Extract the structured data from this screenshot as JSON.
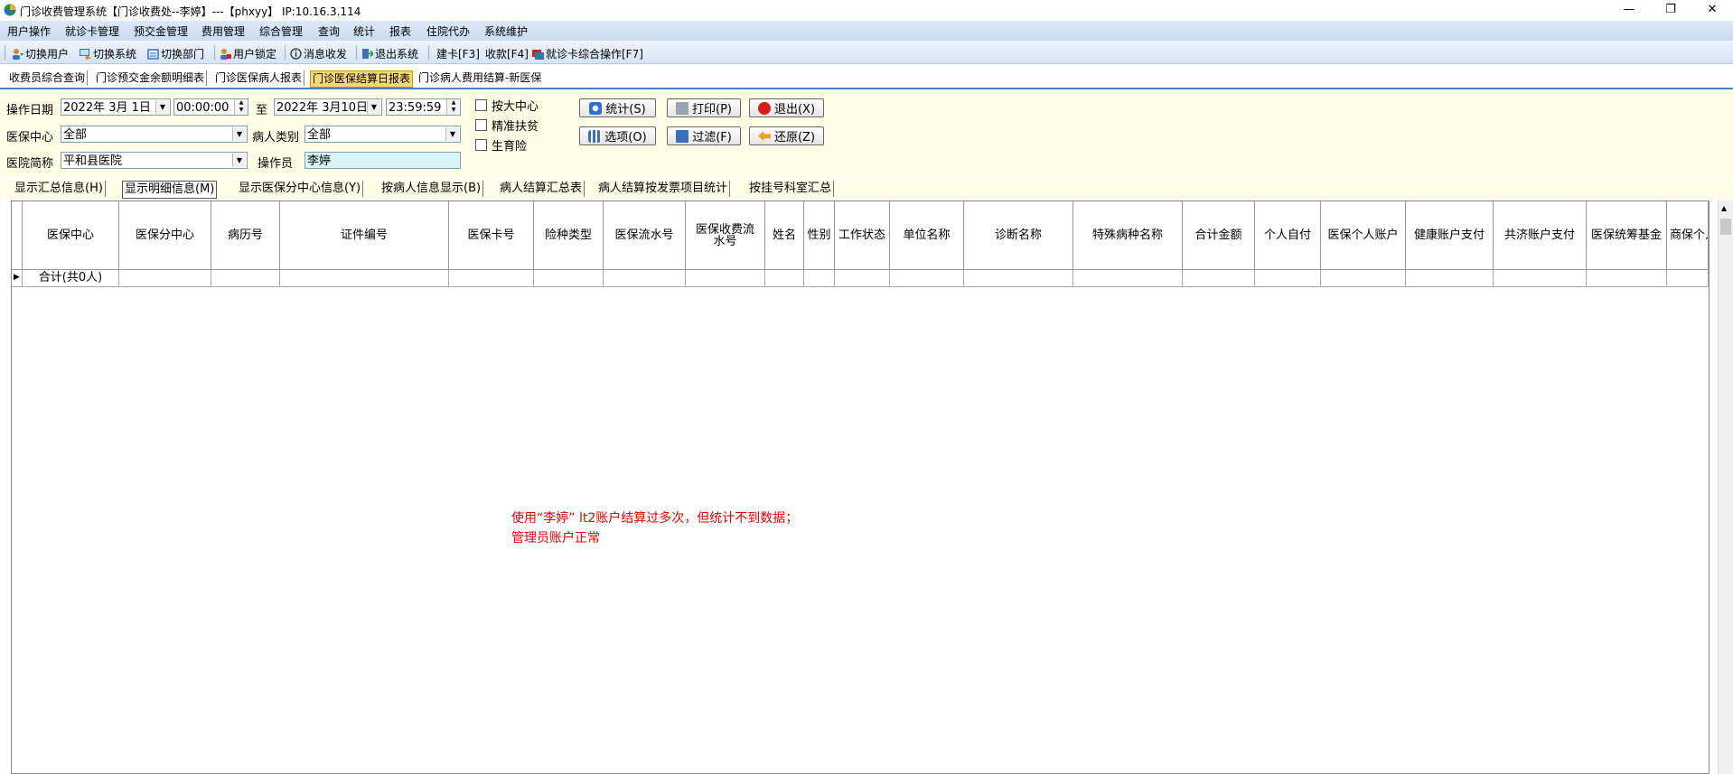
{
  "window": {
    "title": "门诊收费管理系统【门诊收费处--李婷】---【phxyy】 IP:10.16.3.114",
    "controls": [
      "—",
      "❐",
      "✕"
    ]
  },
  "menubar": [
    "用户操作",
    "就诊卡管理",
    "预交金管理",
    "费用管理",
    "综合管理",
    "查询",
    "统计",
    "报表",
    "住院代办",
    "系统维护"
  ],
  "toolbar": [
    {
      "label": "切换用户",
      "icon": "switch-user-icon"
    },
    {
      "label": "切换系统",
      "icon": "switch-system-icon"
    },
    {
      "label": "切换部门",
      "icon": "switch-department-icon"
    },
    {
      "label": "用户锁定",
      "icon": "user-lock-icon"
    },
    {
      "label": "消息收发",
      "icon": "message-icon"
    },
    {
      "label": "退出系统",
      "icon": "exit-icon"
    },
    {
      "label": "建卡[F3]",
      "icon": ""
    },
    {
      "label": "收款[F4]",
      "icon": ""
    },
    {
      "label": "就诊卡综合操作[F7]",
      "icon": "card-ops-icon"
    }
  ],
  "module_tabs": [
    "收费员综合查询",
    "门诊预交金余额明细表",
    "门诊医保病人报表",
    "门诊医保结算日报表",
    "门诊病人费用结算-新医保"
  ],
  "active_module_tab": "门诊医保结算日报表",
  "filters": {
    "op_date_label": "操作日期",
    "start_date": "2022年 3月 1日",
    "start_time": "00:00:00",
    "to_label": "至",
    "end_date": "2022年 3月10日",
    "end_time": "23:59:59",
    "center_label": "医保中心",
    "center_value": "全部",
    "patient_type_label": "病人类别",
    "patient_type_value": "全部",
    "hospital_label": "医院简称",
    "hospital_value": "平和县医院",
    "operator_label": "操作员",
    "operator_value": "李婷",
    "checkboxes": [
      "按大中心",
      "精准扶贫",
      "生育险"
    ]
  },
  "buttons": {
    "stats": "统计(S)",
    "print": "打印(P)",
    "exit": "退出(X)",
    "options": "选项(O)",
    "filter": "过滤(F)",
    "restore": "还原(Z)"
  },
  "view_tabs": [
    "显示汇总信息(H)",
    "显示明细信息(M)",
    "显示医保分中心信息(Y)",
    "按病人信息显示(B)",
    "病人结算汇总表",
    "病人结算按发票项目统计",
    "按挂号科室汇总"
  ],
  "active_view_tab": "显示明细信息(M)",
  "grid": {
    "columns": [
      "医保中心",
      "医保分中心",
      "病历号",
      "证件编号",
      "医保卡号",
      "险种类型",
      "医保流水号",
      "医保收费流水号",
      "姓名",
      "性别",
      "工作状态",
      "单位名称",
      "诊断名称",
      "特殊病种名称",
      "合计金额",
      "个人自付",
      "医保个人账户",
      "健康账户支付",
      "共济账户支付",
      "医保统筹基金",
      "商保个人"
    ],
    "summary_row": "合计(共0人)"
  },
  "note": {
    "line1": "使用“李婷” lt2账户结算过多次，但统计不到数据；",
    "line2": "管理员账户正常",
    "color": "#e60000"
  }
}
